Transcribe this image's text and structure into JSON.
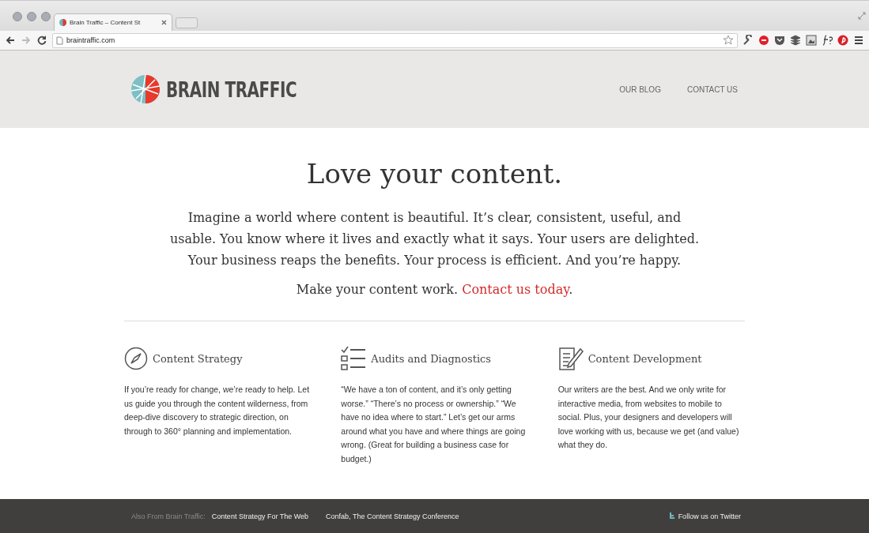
{
  "browser": {
    "tab_title": "Brain Traffic – Content St",
    "url": "braintraffic.com"
  },
  "header": {
    "logo_text": "BRAIN TRAFFIC",
    "nav": [
      "OUR BLOG",
      "CONTACT US"
    ]
  },
  "hero": {
    "title": "Love your content.",
    "body": "Imagine a world where content is beautiful. It’s clear, consistent, useful, and usable. You know where it lives and exactly what it says. Your users are delighted. Your business reaps the benefits. Your process is efficient. And you’re happy.",
    "cta_text": "Make your content work.",
    "cta_link": "Contact us today",
    "cta_end": "."
  },
  "services": [
    {
      "kind": "compass",
      "title": "Content Strategy",
      "text": "If you’re ready for change, we’re ready to help. Let us guide you through the content wilderness, from deep-dive discovery to strategic direction, on through to 360° planning and implementation."
    },
    {
      "kind": "checklist",
      "title": "Audits and Diagnostics",
      "text": "“We have a ton of content, and it’s only getting worse.” “There’s no process or ownership.” “We have no idea where to start.” Let’s get our arms around what you have and where things are going wrong. (Great for building a business case for budget.)"
    },
    {
      "kind": "document",
      "title": "Content Development",
      "text": "Our writers are the best. And we only write for interactive media, from websites to mobile to social. Plus, your designers and developers will love working with us, because we get (and value) what they do."
    }
  ],
  "footer": {
    "label": "Also From Brain Traffic:",
    "links": [
      "Content Strategy For The Web",
      "Confab, The Content Strategy Conference"
    ],
    "twitter": "Follow us on Twitter"
  }
}
